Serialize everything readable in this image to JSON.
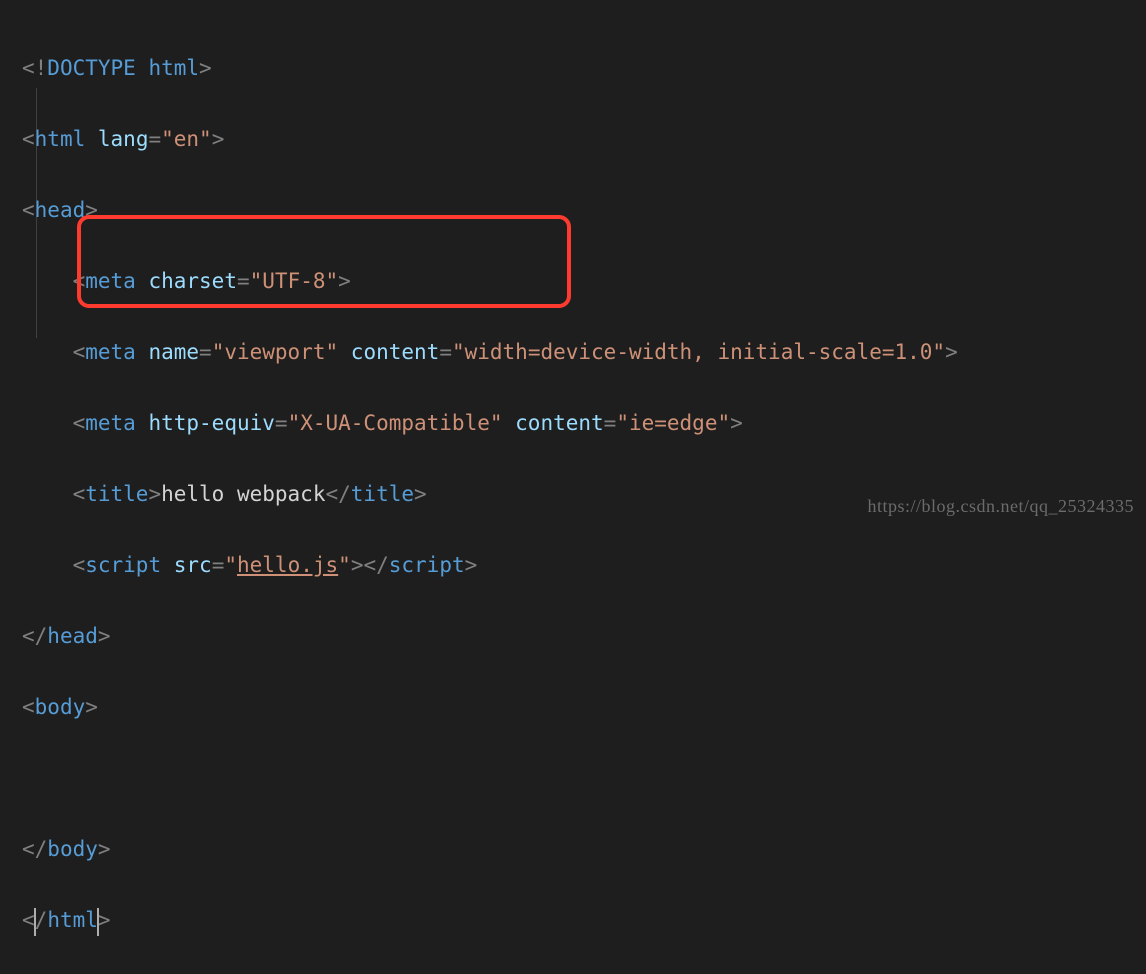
{
  "code": {
    "doctype": "DOCTYPE html",
    "html_open_tag": "html",
    "html_lang_attr": "lang",
    "html_lang_val": "\"en\"",
    "head_tag": "head",
    "meta_tag": "meta",
    "charset_attr": "charset",
    "charset_val": "\"UTF-8\"",
    "name_attr": "name",
    "viewport_val": "\"viewport\"",
    "content_attr": "content",
    "viewport_content_val": "\"width=device-width, initial-scale=1.0\"",
    "httpequiv_attr": "http-equiv",
    "httpequiv_val": "\"X-UA-Compatible\"",
    "ieedge_val": "\"ie=edge\"",
    "title_tag": "title",
    "title_text": "hello webpack",
    "script_tag": "script",
    "src_attr": "src",
    "src_val_open": "\"",
    "src_val_file": "hello.js",
    "src_val_close": "\"",
    "body_tag": "body"
  },
  "watermark": "https://blog.csdn.net/qq_25324335"
}
